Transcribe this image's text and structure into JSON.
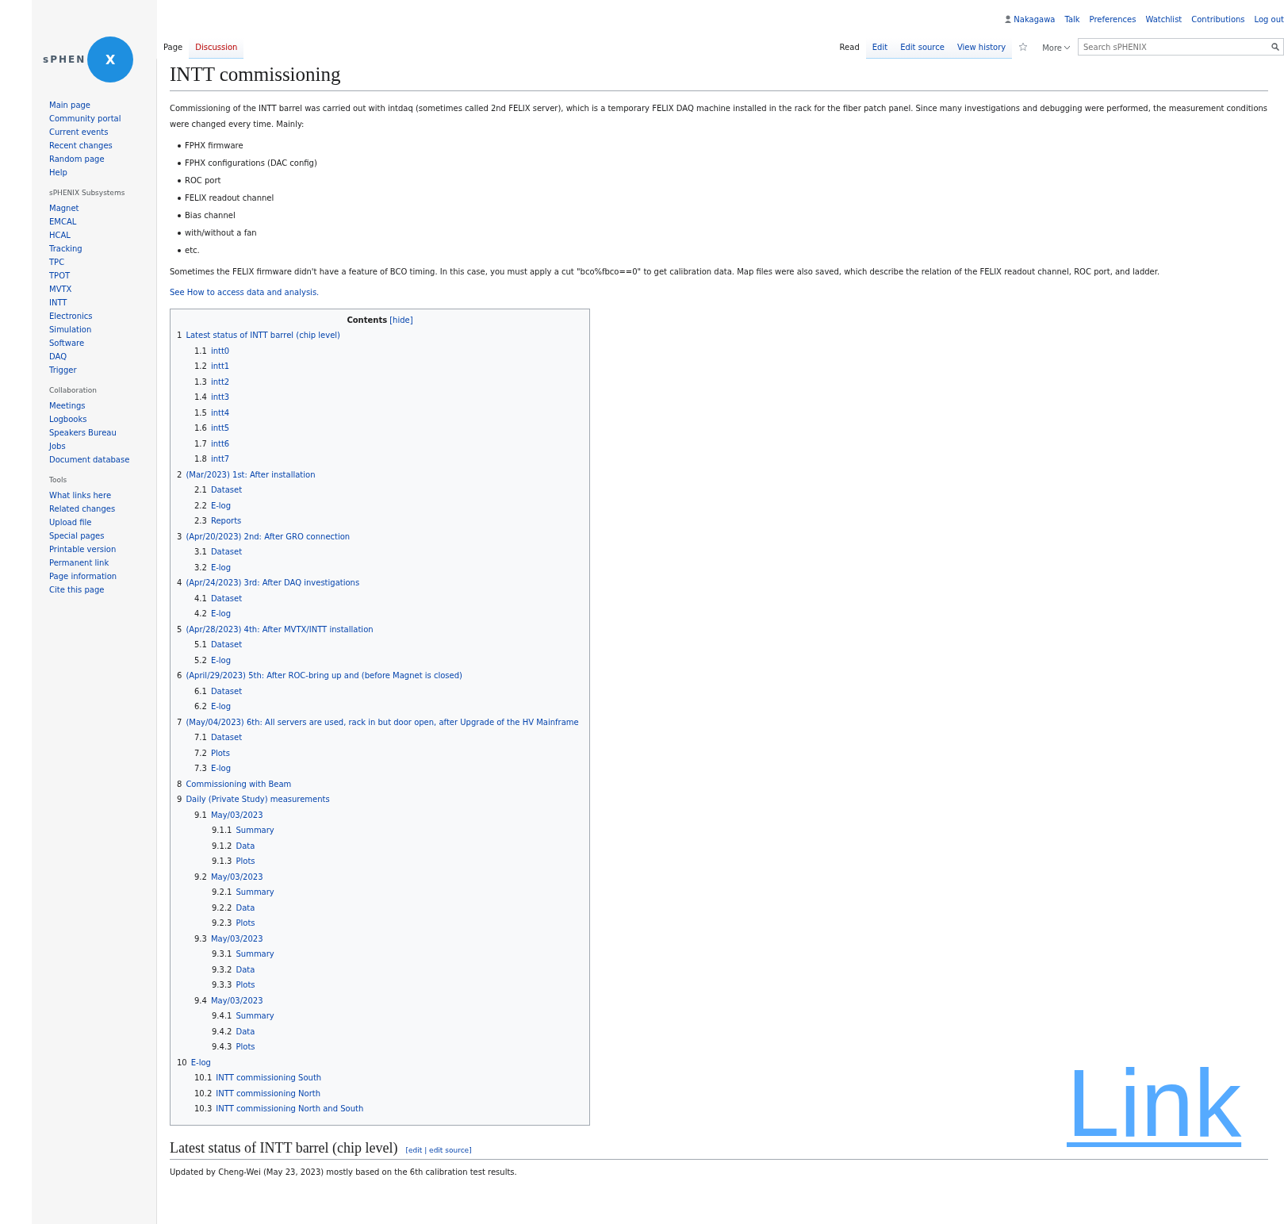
{
  "personal_tools": [
    {
      "label": "Nakagawa",
      "kind": "user"
    },
    {
      "label": "Talk",
      "kind": "link"
    },
    {
      "label": "Preferences",
      "kind": "link"
    },
    {
      "label": "Watchlist",
      "kind": "link"
    },
    {
      "label": "Contributions",
      "kind": "link"
    },
    {
      "label": "Log out",
      "kind": "link"
    }
  ],
  "logo": {
    "text_left": "sPHEN",
    "text_right": "X"
  },
  "namespace_tabs": [
    {
      "label": "Page",
      "selected": true,
      "missing": false
    },
    {
      "label": "Discussion",
      "selected": false,
      "missing": true
    }
  ],
  "view_tabs": [
    {
      "label": "Read",
      "selected": true
    },
    {
      "label": "Edit",
      "selected": false
    },
    {
      "label": "Edit source",
      "selected": false
    },
    {
      "label": "View history",
      "selected": false
    }
  ],
  "more_menu": {
    "label": "More"
  },
  "search": {
    "placeholder": "Search sPHENIX"
  },
  "sidebar": [
    {
      "items": [
        "Main page",
        "Community portal",
        "Current events",
        "Recent changes",
        "Random page",
        "Help"
      ]
    },
    {
      "heading": "sPHENIX Subsystems",
      "items": [
        "Magnet",
        "EMCAL",
        "HCAL",
        "Tracking",
        "TPC",
        "TPOT",
        "MVTX",
        "INTT",
        "Electronics",
        "Simulation",
        "Software",
        "DAQ",
        "Trigger"
      ]
    },
    {
      "heading": "Collaboration",
      "items": [
        "Meetings",
        "Logbooks",
        "Speakers Bureau",
        "Jobs",
        "Document database"
      ]
    },
    {
      "heading": "Tools",
      "items": [
        "What links here",
        "Related changes",
        "Upload file",
        "Special pages",
        "Printable version",
        "Permanent link",
        "Page information",
        "Cite this page"
      ]
    }
  ],
  "title": "INTT commissioning",
  "intro": "Commissioning of the INTT barrel was carried out with intdaq (sometimes called 2nd FELIX server), which is a temporary FELIX DAQ machine installed in the rack for the fiber patch panel. Since many investigations and debugging were performed, the measurement conditions were changed every time. Mainly:",
  "conditions": [
    "FPHX firmware",
    "FPHX configurations (DAC config)",
    "ROC port",
    "FELIX readout channel",
    "Bias channel",
    "with/without a fan",
    "etc."
  ],
  "note": "Sometimes the FELIX firmware didn't have a feature of BCO timing. In this case, you must apply a cut \"bco%fbco==0\" to get calibration data. Map files were also saved, which describe the relation of the FELIX readout channel, ROC port, and ladder.",
  "see_also": "See How to access data and analysis.",
  "toc": {
    "title": "Contents",
    "toggle": "[hide]",
    "items": [
      {
        "number": "1",
        "label": "Latest status of INTT barrel (chip level)",
        "children": [
          {
            "number": "1.1",
            "label": "intt0"
          },
          {
            "number": "1.2",
            "label": "intt1"
          },
          {
            "number": "1.3",
            "label": "intt2"
          },
          {
            "number": "1.4",
            "label": "intt3"
          },
          {
            "number": "1.5",
            "label": "intt4"
          },
          {
            "number": "1.6",
            "label": "intt5"
          },
          {
            "number": "1.7",
            "label": "intt6"
          },
          {
            "number": "1.8",
            "label": "intt7"
          }
        ]
      },
      {
        "number": "2",
        "label": "(Mar/2023) 1st: After installation",
        "children": [
          {
            "number": "2.1",
            "label": "Dataset"
          },
          {
            "number": "2.2",
            "label": "E-log"
          },
          {
            "number": "2.3",
            "label": "Reports"
          }
        ]
      },
      {
        "number": "3",
        "label": "(Apr/20/2023) 2nd: After GRO connection",
        "children": [
          {
            "number": "3.1",
            "label": "Dataset"
          },
          {
            "number": "3.2",
            "label": "E-log"
          }
        ]
      },
      {
        "number": "4",
        "label": "(Apr/24/2023) 3rd: After DAQ investigations",
        "children": [
          {
            "number": "4.1",
            "label": "Dataset"
          },
          {
            "number": "4.2",
            "label": "E-log"
          }
        ]
      },
      {
        "number": "5",
        "label": "(Apr/28/2023) 4th: After MVTX/INTT installation",
        "children": [
          {
            "number": "5.1",
            "label": "Dataset"
          },
          {
            "number": "5.2",
            "label": "E-log"
          }
        ]
      },
      {
        "number": "6",
        "label": "(April/29/2023) 5th: After ROC-bring up and (before Magnet is closed)",
        "children": [
          {
            "number": "6.1",
            "label": "Dataset"
          },
          {
            "number": "6.2",
            "label": "E-log"
          }
        ]
      },
      {
        "number": "7",
        "label": "(May/04/2023) 6th: All servers are used, rack in but door open, after Upgrade of the HV Mainframe",
        "children": [
          {
            "number": "7.1",
            "label": "Dataset"
          },
          {
            "number": "7.2",
            "label": "Plots"
          },
          {
            "number": "7.3",
            "label": "E-log"
          }
        ]
      },
      {
        "number": "8",
        "label": "Commissioning with Beam"
      },
      {
        "number": "9",
        "label": "Daily (Private Study) measurements",
        "children": [
          {
            "number": "9.1",
            "label": "May/03/2023",
            "children": [
              {
                "number": "9.1.1",
                "label": "Summary"
              },
              {
                "number": "9.1.2",
                "label": "Data"
              },
              {
                "number": "9.1.3",
                "label": "Plots"
              }
            ]
          },
          {
            "number": "9.2",
            "label": "May/03/2023",
            "children": [
              {
                "number": "9.2.1",
                "label": "Summary"
              },
              {
                "number": "9.2.2",
                "label": "Data"
              },
              {
                "number": "9.2.3",
                "label": "Plots"
              }
            ]
          },
          {
            "number": "9.3",
            "label": "May/03/2023",
            "children": [
              {
                "number": "9.3.1",
                "label": "Summary"
              },
              {
                "number": "9.3.2",
                "label": "Data"
              },
              {
                "number": "9.3.3",
                "label": "Plots"
              }
            ]
          },
          {
            "number": "9.4",
            "label": "May/03/2023",
            "children": [
              {
                "number": "9.4.1",
                "label": "Summary"
              },
              {
                "number": "9.4.2",
                "label": "Data"
              },
              {
                "number": "9.4.3",
                "label": "Plots"
              }
            ]
          }
        ]
      },
      {
        "number": "10",
        "label": "E-log",
        "children": [
          {
            "number": "10.1",
            "label": "INTT commissioning South"
          },
          {
            "number": "10.2",
            "label": "INTT commissioning North"
          },
          {
            "number": "10.3",
            "label": "INTT commissioning North and South"
          }
        ]
      }
    ]
  },
  "section": {
    "heading": "Latest status of INTT barrel (chip level)",
    "edit_links": "[edit | edit source]",
    "text": "Updated by Cheng-Wei (May 23, 2023) mostly based on the 6th calibration test results."
  },
  "overlay_link": "Link"
}
